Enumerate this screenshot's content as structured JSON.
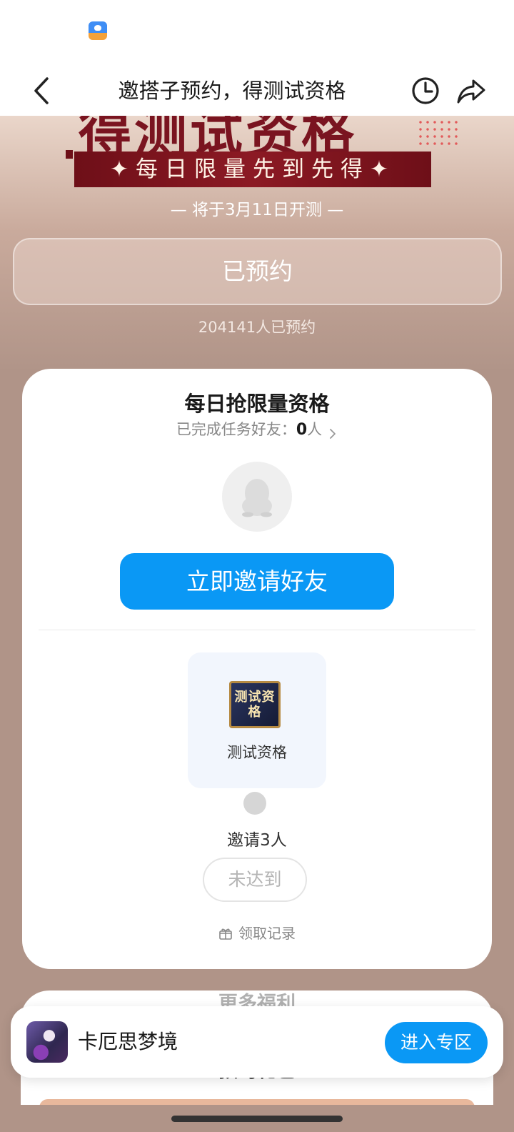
{
  "header": {
    "title": "邀搭子预约，得测试资格"
  },
  "banner": {
    "big_text": "得测试资格",
    "ribbon": "✦每日限量先到先得✦",
    "date_line": "— 将于3月11日开测 —"
  },
  "reservation": {
    "button_label": "已预约",
    "count_text": "204141人已预约"
  },
  "task_card": {
    "title": "每日抢限量资格",
    "friends_label": "已完成任务好友：",
    "friends_count": "0",
    "friends_unit": "人",
    "invite_button": "立即邀请好友",
    "reward_badge": "测试资格",
    "reward_label": "测试资格",
    "goal_text": "邀请3人",
    "status_button": "未达到",
    "record_link": "领取记录"
  },
  "lower_section": {
    "heading_partial": "更多福利",
    "heading": "预约礼包"
  },
  "app_bar": {
    "app_name": "卡厄思梦境",
    "enter_button": "进入专区"
  },
  "colors": {
    "primary_blue": "#0a98f5",
    "page_background": "#b09488",
    "banner_red": "#7a1420"
  }
}
